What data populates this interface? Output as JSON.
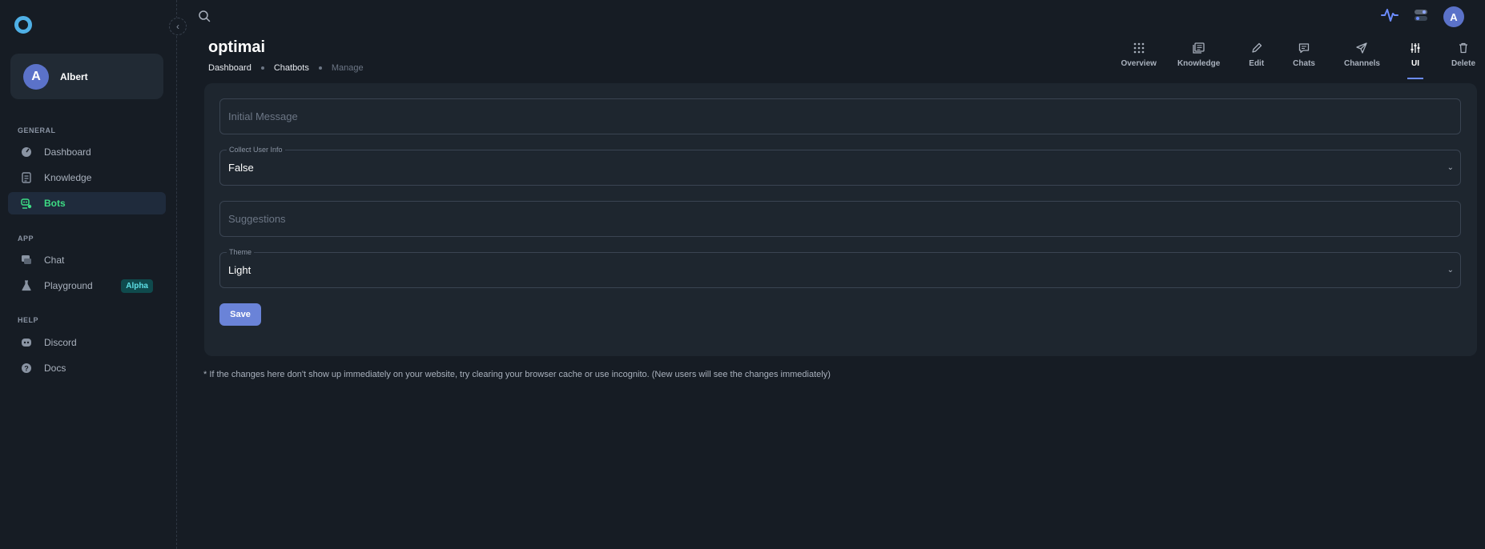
{
  "user": {
    "initial": "A",
    "name": "Albert"
  },
  "sidebar": {
    "sections": [
      {
        "title": "GENERAL",
        "items": [
          {
            "label": "Dashboard",
            "icon": "dashboard-icon"
          },
          {
            "label": "Knowledge",
            "icon": "document-icon"
          },
          {
            "label": "Bots",
            "icon": "bot-icon",
            "active": true
          }
        ]
      },
      {
        "title": "APP",
        "items": [
          {
            "label": "Chat",
            "icon": "chat-icon"
          },
          {
            "label": "Playground",
            "icon": "flask-icon",
            "badge": "Alpha"
          }
        ]
      },
      {
        "title": "HELP",
        "items": [
          {
            "label": "Discord",
            "icon": "discord-icon"
          },
          {
            "label": "Docs",
            "icon": "help-icon"
          }
        ]
      }
    ]
  },
  "topbar": {
    "avatar_initial": "A"
  },
  "header": {
    "title": "optimai",
    "breadcrumb": [
      "Dashboard",
      "Chatbots",
      "Manage"
    ]
  },
  "tabs": [
    {
      "label": "Overview",
      "icon": "grid-icon"
    },
    {
      "label": "Knowledge",
      "icon": "book-icon"
    },
    {
      "label": "Edit",
      "icon": "pencil-icon"
    },
    {
      "label": "Chats",
      "icon": "message-icon"
    },
    {
      "label": "Channels",
      "icon": "send-icon"
    },
    {
      "label": "UI",
      "icon": "sliders-icon",
      "active": true
    },
    {
      "label": "Delete",
      "icon": "trash-icon"
    }
  ],
  "form": {
    "initial_message": {
      "placeholder": "Initial Message"
    },
    "collect_user_info": {
      "label": "Collect User Info",
      "value": "False"
    },
    "suggestions": {
      "placeholder": "Suggestions"
    },
    "theme": {
      "label": "Theme",
      "value": "Light"
    },
    "save_label": "Save"
  },
  "footnote": "* If the changes here don't show up immediately on your website, try clearing your browser cache or use incognito. (New users will see the changes immediately)",
  "colors": {
    "accent": "#6a83d8",
    "active_nav": "#3ddc84",
    "background": "#161c24",
    "card": "#1e262f"
  }
}
